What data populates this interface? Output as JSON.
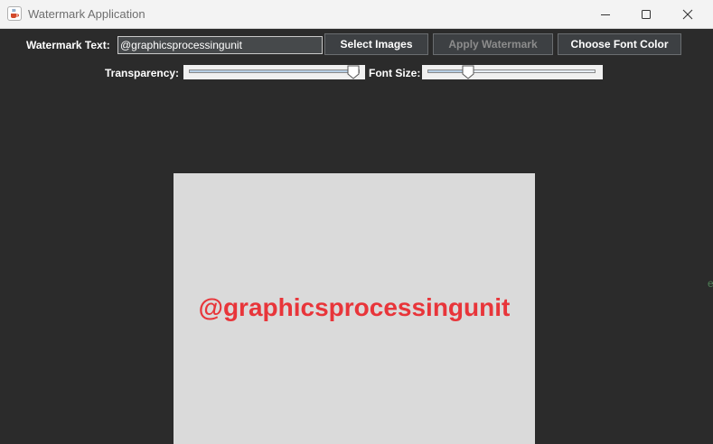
{
  "window": {
    "title": "Watermark Application",
    "icon": "java-coffee-cup-icon",
    "controls": [
      "minimize-icon",
      "maximize-icon",
      "close-icon"
    ]
  },
  "toolbar": {
    "watermark_text_label": "Watermark Text:",
    "watermark_text_value": "@graphicsprocessingunit",
    "select_images_label": "Select Images",
    "apply_watermark_label": "Apply Watermark",
    "apply_watermark_enabled": false,
    "choose_font_color_label": "Choose Font Color"
  },
  "sliders": {
    "transparency_label": "Transparency:",
    "transparency_value": 1.0,
    "font_size_label": "Font Size:",
    "font_size_value": 0.22
  },
  "preview": {
    "watermark_text": "@graphicsprocessingunit",
    "watermark_color": "#e8353a",
    "background_color": "#dadada"
  },
  "edge_text": "e",
  "colors": {
    "window_bg": "#2b2b2b",
    "titlebar_bg": "#f3f3f3",
    "button_bg": "#3d4043"
  }
}
